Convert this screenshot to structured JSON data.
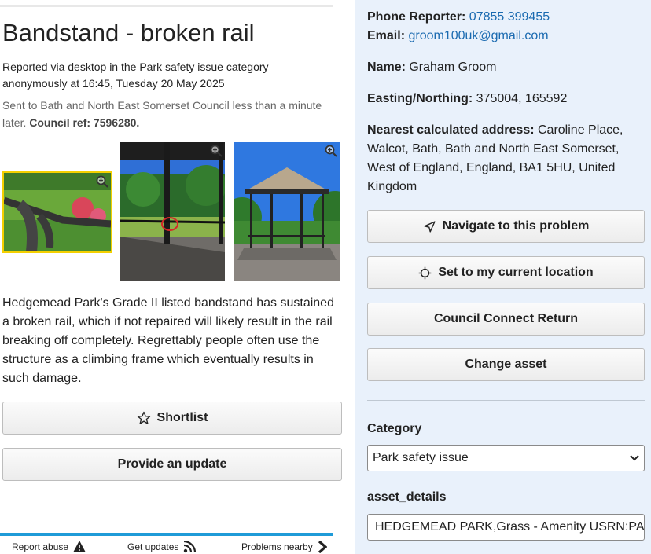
{
  "report": {
    "title": "Bandstand - broken rail",
    "meta_line1": "Reported via desktop in the Park safety issue category",
    "meta_line2": "anonymously at 16:45, Tuesday 20 May 2025",
    "sent_text": "Sent to Bath and North East Somerset Council less than a minute later.",
    "council_ref_label": "Council ref: 7596280.",
    "description": "Hedgemead Park's Grade II listed bandstand has sustained a broken rail, which if not repaired will likely result in the rail breaking off completely. Regrettably people often use the structure as a climbing frame which eventually results in such damage."
  },
  "photos": [
    {
      "icon": "zoom-in-icon"
    },
    {
      "icon": "zoom-in-icon"
    },
    {
      "icon": "zoom-in-icon"
    }
  ],
  "actions": {
    "shortlist_label": "Shortlist",
    "update_label": "Provide an update"
  },
  "footer_nav": {
    "report_abuse": "Report abuse",
    "get_updates": "Get updates",
    "problems_nearby": "Problems nearby"
  },
  "reporter": {
    "phone_label": "Phone Reporter:",
    "phone": "07855 399455",
    "email_label": "Email:",
    "email": "groom100uk@gmail.com",
    "name_label": "Name:",
    "name": "Graham Groom",
    "easting_label": "Easting/Northing:",
    "easting": "375004, 165592",
    "address_label": "Nearest calculated address:",
    "address": "Caroline Place, Walcot, Bath, Bath and North East Somerset, West of England, England, BA1 5HU, United Kingdom"
  },
  "admin_buttons": {
    "navigate": "Navigate to this problem",
    "set_location": "Set to my current location",
    "council_connect": "Council Connect Return",
    "change_asset": "Change asset"
  },
  "form": {
    "category_label": "Category",
    "category_value": "Park safety issue",
    "asset_label": "asset_details",
    "asset_value": "HEDGEMEAD PARK,Grass - Amenity USRN:PA"
  },
  "colors": {
    "link": "#1a6ab0",
    "sidebar_bg": "#e9f1fb",
    "accent_rule": "#1f9bd8",
    "selected_photo_border": "#f4d000"
  }
}
